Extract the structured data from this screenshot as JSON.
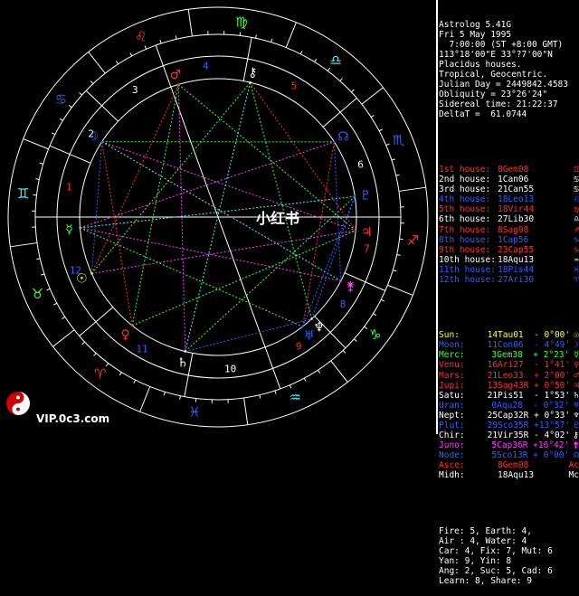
{
  "header": [
    "Astrolog 5.41G",
    "Fri 5 May 1995",
    "  7:00:00 (ST +8:00 GMT)",
    "113°18'00\"E 33°?7'00\"N",
    "Placidus houses.",
    "Tropical, Geocentric.",
    "Julian Day = 2449842.4583",
    "Obliquity = 23°26'24\"",
    "Sidereal time: 21:22:37",
    "DeltaT =  61.0744"
  ],
  "houses": [
    {
      "label": "1st house:",
      "value": "8Gem08",
      "color": "#ff3030",
      "sym": "♊"
    },
    {
      "label": "2nd house:",
      "value": "1Can06",
      "color": "#ffffff",
      "sym": "♋"
    },
    {
      "label": "3rd house:",
      "value": "21Can55",
      "color": "#ffffff",
      "sym": "♋"
    },
    {
      "label": "4th house:",
      "value": "18Leo13",
      "color": "#3060ff",
      "sym": "♌"
    },
    {
      "label": "5th house:",
      "value": "18Vir44",
      "color": "#ff3030",
      "sym": "♍"
    },
    {
      "label": "6th house:",
      "value": "27Lib30",
      "color": "#ffffff",
      "sym": "♎"
    },
    {
      "label": "7th house:",
      "value": "8Sag08",
      "color": "#ff3030",
      "sym": "♐"
    },
    {
      "label": "8th house:",
      "value": "1Cap56",
      "color": "#3060ff",
      "sym": "♑"
    },
    {
      "label": "9th house:",
      "value": "23Cap55",
      "color": "#ff3030",
      "sym": "♑"
    },
    {
      "label": "10th house:",
      "value": "18Aqu13",
      "color": "#ffffff",
      "sym": "♒"
    },
    {
      "label": "11th house:",
      "value": "18Pis44",
      "color": "#3060ff",
      "sym": "♓"
    },
    {
      "label": "12th house:",
      "value": "27Ari30",
      "color": "#3060ff",
      "sym": "♈"
    }
  ],
  "planets": [
    {
      "label": "Sun:",
      "value": "14Tau01  - 0°00'",
      "color": "#ffff40",
      "sym": "☉"
    },
    {
      "label": "Moon:",
      "value": "11Con06  - 4°49'",
      "color": "#3060ff",
      "sym": "☽"
    },
    {
      "label": "Merc:",
      "value": "3Gem38  + 2°23'",
      "color": "#40ff40",
      "sym": "☿"
    },
    {
      "label": "Venu:",
      "value": "16Ari27  - 1°41'",
      "color": "#ff3030",
      "sym": "♀"
    },
    {
      "label": "Mars:",
      "value": "21Leo33  + 2°00'",
      "color": "#ff3030",
      "sym": "♂"
    },
    {
      "label": "Jupi:",
      "value": "13Sag43R + 0°50'",
      "color": "#ff3030",
      "sym": "♃"
    },
    {
      "label": "Satu:",
      "value": "21Pis51  - 1°53'",
      "color": "#ffffff",
      "sym": "♄"
    },
    {
      "label": "Uran:",
      "value": "0Aqu28  - 0°32'",
      "color": "#3060ff",
      "sym": "♅"
    },
    {
      "label": "Nept:",
      "value": "25Cap32R + 0°33'",
      "color": "#ffffff",
      "sym": "♆"
    },
    {
      "label": "Plut:",
      "value": "29Sco35R +13°57'",
      "color": "#3060ff",
      "sym": "♇"
    },
    {
      "label": "Chir:",
      "value": "21Vir35R - 4°02'",
      "color": "#ffffff",
      "sym": "⚷"
    },
    {
      "label": "Juno:",
      "value": "5Cap36R +16°42'",
      "color": "#ff40ff",
      "sym": "⚵"
    },
    {
      "label": "Node:",
      "value": "5Sco13R + 0°00'",
      "color": "#3060ff",
      "sym": "☊"
    },
    {
      "label": "Asce:",
      "value": "8Gem08",
      "color": "#ff3030",
      "sym": "Ac"
    },
    {
      "label": "Midh:",
      "value": "18Aqu13",
      "color": "#ffffff",
      "sym": "Mc"
    }
  ],
  "footer": [
    "Fire: 5, Earth: 4,",
    "Air : 4, Water: 4",
    "Car: 4, Fix: 7, Mut: 6",
    "Yan: 9, Yin: 8",
    "Ang: 2, Suc: 5, Cad: 6",
    "Learn: 8, Share: 9"
  ],
  "watermark": {
    "url": "VIP.0c3.com",
    "center": "小红书"
  },
  "zodiac": [
    "♈",
    "♉",
    "♊",
    "♋",
    "♌",
    "♍",
    "♎",
    "♏",
    "♐",
    "♑",
    "♒",
    "♓"
  ],
  "zodiac_colors": [
    "#ff3030",
    "#40ff40",
    "#40ffff",
    "#3060ff",
    "#ff3030",
    "#40ff40",
    "#40ffff",
    "#3060ff",
    "#ff3030",
    "#40ff40",
    "#40ffff",
    "#3060ff"
  ],
  "house_numbers": [
    "1",
    "2",
    "3",
    "4",
    "5",
    "6",
    "7",
    "8",
    "9",
    "10",
    "11",
    "12"
  ],
  "chart_planets": [
    {
      "sym": "☉",
      "lon": 44.02,
      "color": "#ffff40"
    },
    {
      "sym": "☽",
      "lon": 101.1,
      "color": "#3060ff"
    },
    {
      "sym": "☿",
      "lon": 63.63,
      "color": "#40ff40"
    },
    {
      "sym": "♀",
      "lon": 16.45,
      "color": "#ff3030"
    },
    {
      "sym": "♂",
      "lon": 141.55,
      "color": "#ff3030"
    },
    {
      "sym": "♃",
      "lon": 253.72,
      "color": "#ff3030"
    },
    {
      "sym": "♄",
      "lon": 351.85,
      "color": "#ffffff"
    },
    {
      "sym": "♅",
      "lon": 300.47,
      "color": "#3060ff"
    },
    {
      "sym": "♆",
      "lon": 295.53,
      "color": "#ffffff"
    },
    {
      "sym": "♇",
      "lon": 239.58,
      "color": "#3060ff"
    },
    {
      "sym": "⚷",
      "lon": 171.58,
      "color": "#ffffff"
    },
    {
      "sym": "⚵",
      "lon": 275.6,
      "color": "#ff40ff"
    },
    {
      "sym": "☊",
      "lon": 215.22,
      "color": "#3060ff"
    }
  ],
  "cusps": [
    68.13,
    91.1,
    111.92,
    138.22,
    168.73,
    207.5,
    248.13,
    271.93,
    293.92,
    318.22,
    348.73,
    27.5
  ]
}
